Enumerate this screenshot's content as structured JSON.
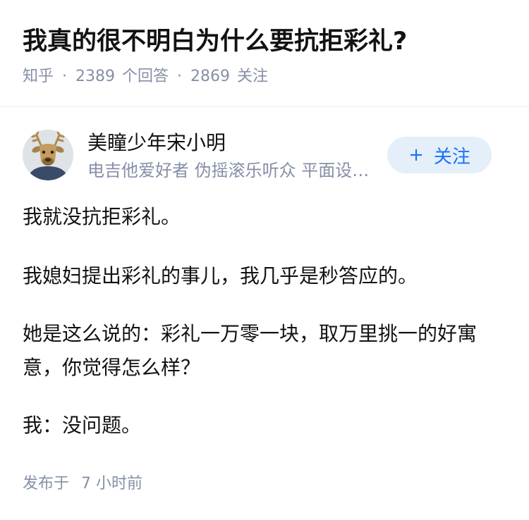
{
  "question": {
    "title": "我真的很不明白为什么要抗拒彩礼?",
    "source": "知乎",
    "answers_count": "2389",
    "answers_label": "个回答",
    "followers_count": "2869",
    "followers_label": "关注",
    "separator": "·"
  },
  "author": {
    "name": "美瞳少年宋小明",
    "bio": "电吉他爱好者 伪摇滚乐听众 平面设计师",
    "avatar_icon": "deer-mask-avatar"
  },
  "follow_button": {
    "icon": "plus-icon",
    "icon_glyph": "+",
    "label": "关注",
    "color": "#1772f6",
    "background": "#e5eff9"
  },
  "answer": {
    "paragraphs": [
      "我就没抗拒彩礼。",
      "我媳妇提出彩礼的事儿，我几乎是秒答应的。",
      "她是这么说的：彩礼一万零一块，取万里挑一的好寓意，你觉得怎么样？",
      "我：没问题。"
    ],
    "publish_prefix": "发布于",
    "publish_time": "7 小时前"
  }
}
